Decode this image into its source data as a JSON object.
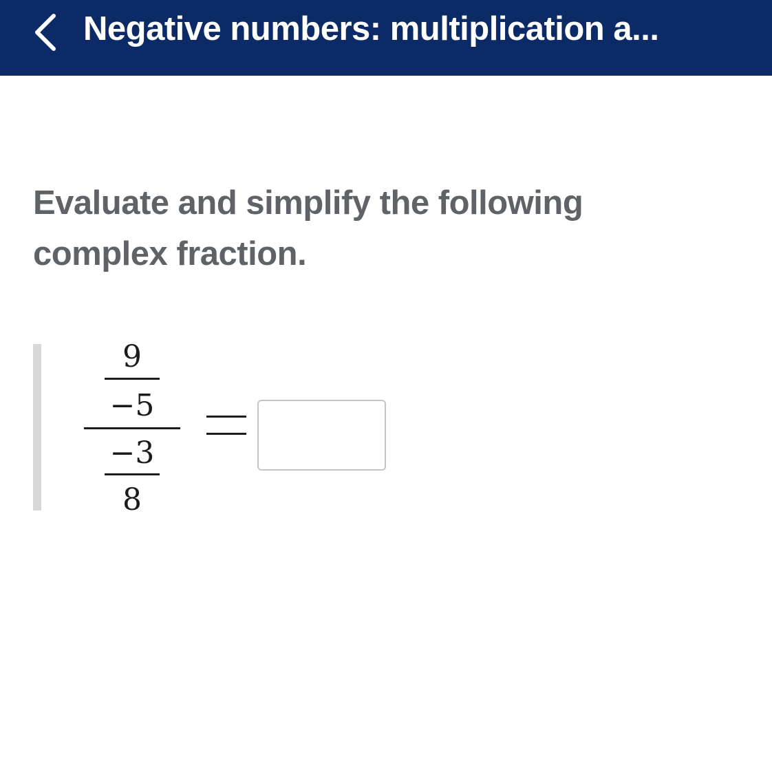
{
  "header": {
    "back_icon": "chevron-left-icon",
    "title": "Negative numbers: multiplication a...",
    "background_color": "#0b2a66"
  },
  "question": {
    "instruction": "Evaluate and simplify the following complex fraction.",
    "expression": {
      "top_fraction": {
        "numerator": "9",
        "denominator": "−5"
      },
      "bottom_fraction": {
        "numerator": "−3",
        "denominator": "8"
      },
      "equals": "="
    },
    "answer": {
      "value": "",
      "placeholder": ""
    }
  }
}
